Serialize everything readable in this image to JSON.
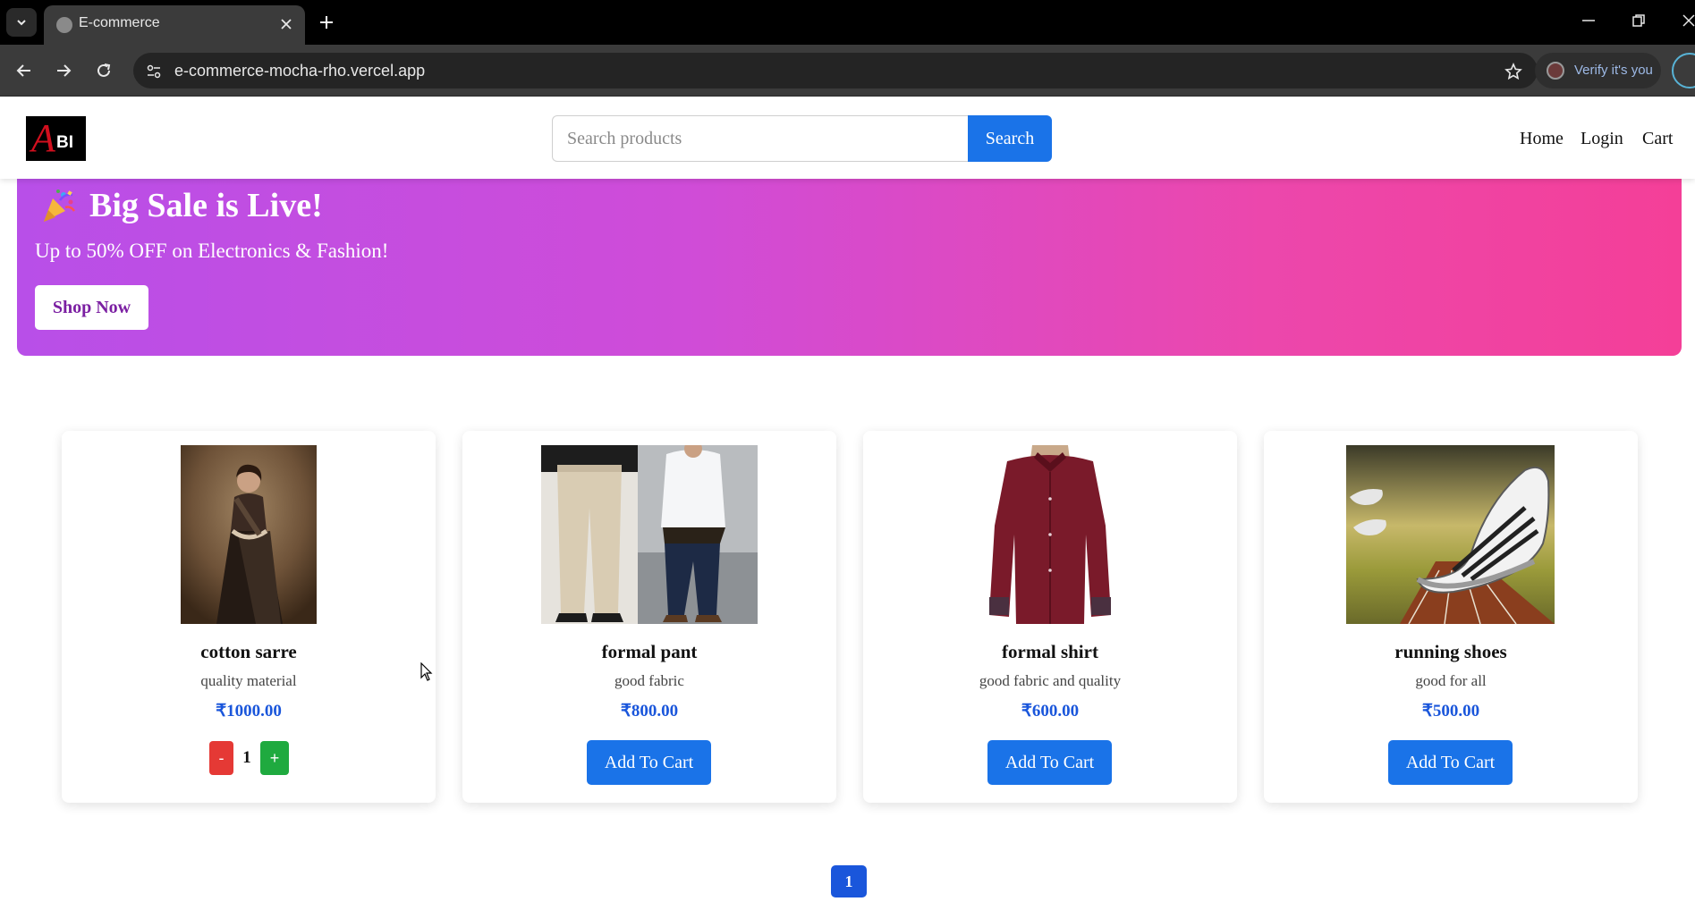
{
  "browser": {
    "tab_title": "E-commerce",
    "url": "e-commerce-mocha-rho.vercel.app",
    "verify_label": "Verify it's you"
  },
  "header": {
    "logo_letter": "A",
    "logo_suffix": "BI",
    "search_placeholder": "Search products",
    "search_label": "Search",
    "nav": [
      "Home",
      "Login",
      "Cart"
    ]
  },
  "banner": {
    "title": "Big Sale is Live!",
    "subtitle": "Up to 50% OFF on Electronics & Fashion!",
    "cta": "Shop Now",
    "icon": "party-popper-icon"
  },
  "products": [
    {
      "name": "cotton sarre",
      "description": "quality material",
      "price": "₹1000.00",
      "in_cart": true,
      "quantity": "1",
      "minus_label": "-",
      "plus_label": "+"
    },
    {
      "name": "formal pant",
      "description": "good fabric",
      "price": "₹800.00",
      "in_cart": false,
      "button": "Add To Cart"
    },
    {
      "name": "formal shirt",
      "description": "good fabric and quality",
      "price": "₹600.00",
      "in_cart": false,
      "button": "Add To Cart"
    },
    {
      "name": "running shoes",
      "description": "good for all",
      "price": "₹500.00",
      "in_cart": false,
      "button": "Add To Cart"
    }
  ],
  "pagination": {
    "current": "1"
  },
  "colors": {
    "primary": "#1a73e8",
    "price": "#1a56db",
    "minus": "#e53935",
    "plus": "#1faa3f",
    "banner_start": "#b84fe8",
    "banner_end": "#f43f98"
  }
}
